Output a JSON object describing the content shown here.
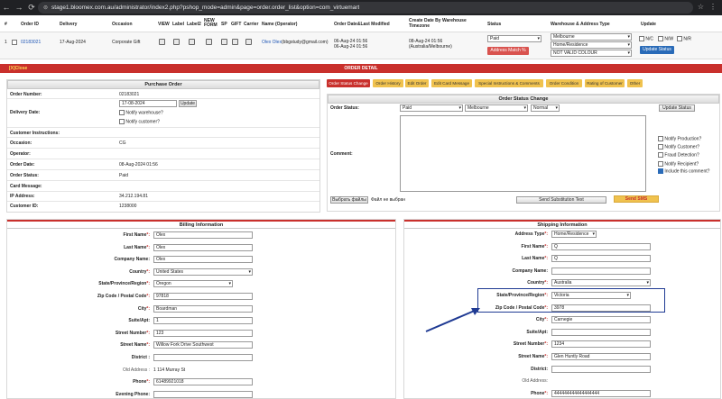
{
  "browser": {
    "site_label": "⊜",
    "url": "stage1.bloomex.com.au/administrator/index2.php?pshop_mode=admin&page=order.order_list&option=com_virtuemart"
  },
  "list": {
    "headers": {
      "num": "#",
      "order_id": "Order ID",
      "delivery": "Delivery",
      "occasion": "Occasion",
      "view": "VIEW",
      "label": "Label",
      "label2": "Label2",
      "new_form": "NEW FORM",
      "sp": "SP",
      "gift": "GIFT",
      "carrier": "Carrier",
      "name": "Name (Operator)",
      "order_date": "Order Date&Last Modified",
      "create_date": "Create Date By Warehouse Timezone",
      "status": "Status",
      "warehouse": "Warehouse & Address Type",
      "update": "Update"
    },
    "row": {
      "num": "1",
      "order_id": "02183021",
      "delivery": "17-Aug-2024",
      "occasion": "Corporate Gift",
      "name": "Olex Olex",
      "email": "(bbgstudy@gmail.com)",
      "order_date_1": "06-Aug-24 01:56",
      "order_date_2": "06-Aug-24 01:56",
      "create_date_1": "08-Aug-24 01:56",
      "create_date_2": "(Australia/Melbourne)",
      "status": "Paid",
      "address_match_button": "Address Match %",
      "warehouse": "Melbourne",
      "address_type": "Home/Residence",
      "colour": "NOT VALID COLOUR",
      "n_c": "N/C",
      "n_w": "N/W",
      "n_r": "N/R",
      "update_status_button": "Update Status"
    }
  },
  "detail": {
    "close_label": "[X]Close",
    "title": "ORDER DETAIL"
  },
  "purchase_order": {
    "title": "Purchase Order",
    "order_number_label": "Order Number:",
    "order_number": "02183021",
    "delivery_date_label": "Delivery Date:",
    "delivery_date_value": "17-08-2024",
    "update_button": "Update",
    "notify_warehouse": "Notify warehouse?",
    "notify_customer": "Notify customer?",
    "customer_instructions_label": "Customer Instructions:",
    "occasion_label": "Occasion:",
    "occasion": "CG",
    "operator_label": "Operator:",
    "order_date_label": "Order Date:",
    "order_date": "08-Aug-2024 01:56",
    "order_status_label": "Order Status:",
    "order_status": "Paid",
    "card_message_label": "Card Message:",
    "ip_label": "IP Address:",
    "ip": "34.212.194.81",
    "customer_id_label": "Customer ID:",
    "customer_id": "1238000"
  },
  "tabs": [
    "Order Status Change",
    "Order History",
    "Edit Order",
    "Edit Card Message",
    "Special Instructions & Comments",
    "Order Condition",
    "Rating of Customer",
    "Other"
  ],
  "status_change": {
    "title": "Order Status Change",
    "order_status_label": "Order Status:",
    "status": "Paid",
    "warehouse": "Melbourne",
    "priority": "Normal",
    "update_button": "Update Status",
    "comment_label": "Comment:",
    "checks": [
      "Notify Production?",
      "Notify Customer?",
      "Fraud Detection?",
      "Notify Recipient?",
      "Include this comment?"
    ],
    "file_button": "Выбрать файлы",
    "file_none": "Файл не выбран",
    "send_sub_button": "Send Substitution Text",
    "send_sms_button": "Send SMS"
  },
  "billing": {
    "title": "Billing Information",
    "fields": [
      {
        "label": "First Name",
        "req": true,
        "value": "Olex"
      },
      {
        "label": "Last Name",
        "req": true,
        "value": "Olex"
      },
      {
        "label": "Company Name:",
        "req": false,
        "value": "Olex"
      },
      {
        "label": "Country",
        "req": true,
        "value": "United States"
      },
      {
        "label": "State/Province/Region",
        "req": true,
        "value": "Oregon"
      },
      {
        "label": "Zip Code / Postal Code",
        "req": true,
        "value": "97818"
      },
      {
        "label": "City",
        "req": true,
        "value": "Boardman"
      },
      {
        "label": "Suite/Apt:",
        "req": false,
        "value": "1"
      },
      {
        "label": "Street Number",
        "req": true,
        "value": "123"
      },
      {
        "label": "Street Name",
        "req": true,
        "value": "Willow Fork Drive Southwest"
      },
      {
        "label": "District :",
        "req": false,
        "value": ""
      },
      {
        "label": "Old Address :",
        "req": false,
        "value": "1 114 Murray St"
      },
      {
        "label": "Phone",
        "req": true,
        "value": "61489921018"
      },
      {
        "label": "Evening Phone:",
        "req": false,
        "value": ""
      }
    ]
  },
  "shipping": {
    "title": "Shipping Information",
    "fields": [
      {
        "label": "Address Type",
        "req": true,
        "value": "Home/Residence"
      },
      {
        "label": "First Name",
        "req": true,
        "value": "Q"
      },
      {
        "label": "Last Name",
        "req": true,
        "value": "Q"
      },
      {
        "label": "Company Name:",
        "req": false,
        "value": ""
      },
      {
        "label": "Country",
        "req": true,
        "value": "Australia"
      },
      {
        "label": "State/Province/Region",
        "req": true,
        "value": "Victoria"
      },
      {
        "label": "Zip Code / Postal Code",
        "req": true,
        "value": "3978"
      },
      {
        "label": "City",
        "req": true,
        "value": "Carnegie"
      },
      {
        "label": "Suite/Apt:",
        "req": false,
        "value": ""
      },
      {
        "label": "Street Number",
        "req": true,
        "value": "1234"
      },
      {
        "label": "Street Name",
        "req": true,
        "value": "Glen Huntly Road"
      },
      {
        "label": "District:",
        "req": false,
        "value": ""
      },
      {
        "label": "Old Address:",
        "req": false,
        "value": ""
      },
      {
        "label": "Phone",
        "req": true,
        "value": "444444444444444444"
      }
    ]
  },
  "colors": {
    "accent_red": "#c9302c",
    "tab_yellow": "#f0c24e",
    "button_blue": "#2a6bb8",
    "annotation": "#1f3a93"
  }
}
